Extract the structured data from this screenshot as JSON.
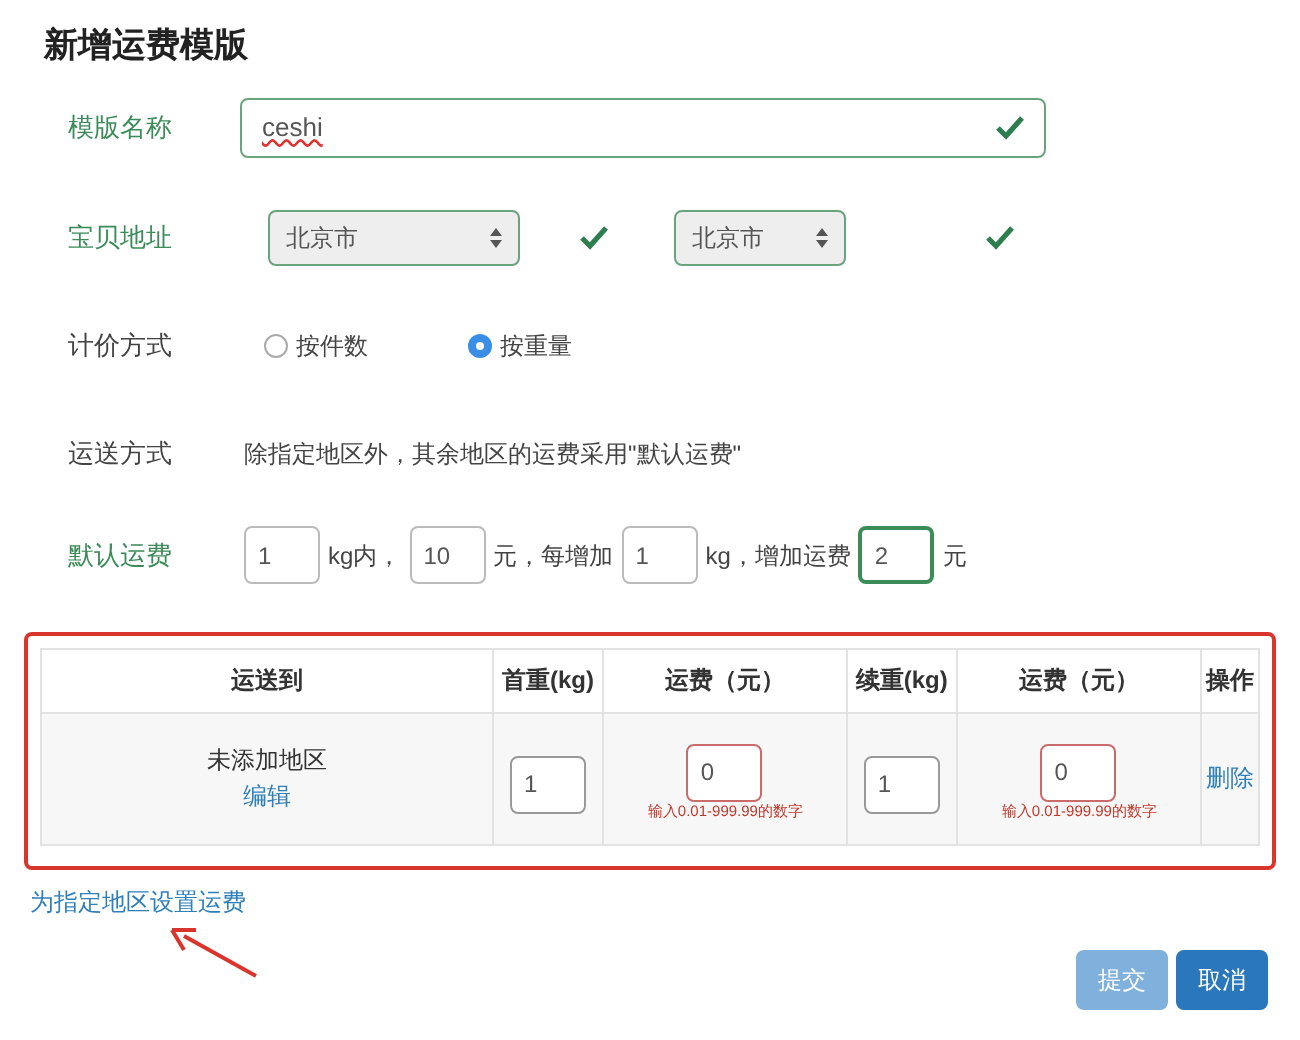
{
  "title": "新增运费模版",
  "name_field": {
    "label": "模版名称",
    "value": "ceshi",
    "valid": true
  },
  "address": {
    "label": "宝贝地址",
    "valid": true,
    "selects": [
      {
        "value": "北京市",
        "valid": true
      },
      {
        "value": "北京市",
        "valid": true
      }
    ]
  },
  "pricing": {
    "label": "计价方式",
    "options": [
      {
        "label": "按件数",
        "selected": false
      },
      {
        "label": "按重量",
        "selected": true
      }
    ]
  },
  "shipping": {
    "label": "运送方式",
    "note": "除指定地区外，其余地区的运费采用\"默认运费\""
  },
  "default_fee": {
    "label": "默认运费",
    "valid": true,
    "parts": [
      {
        "kind": "input",
        "value": "1",
        "focused": false
      },
      {
        "kind": "text",
        "text": "kg内，"
      },
      {
        "kind": "input",
        "value": "10",
        "focused": false
      },
      {
        "kind": "text",
        "text": "元，每增加"
      },
      {
        "kind": "input",
        "value": "1",
        "focused": false
      },
      {
        "kind": "text",
        "text": "kg，增加运费"
      },
      {
        "kind": "input",
        "value": "2",
        "focused": true
      },
      {
        "kind": "text",
        "text": "元"
      }
    ]
  },
  "table": {
    "columns": [
      "运送到",
      "首重(kg)",
      "运费（元）",
      "续重(kg)",
      "运费（元）",
      "操作"
    ],
    "rows": [
      {
        "cells": [
          {
            "kind": "region",
            "text": "未添加地区",
            "link": "编辑"
          },
          {
            "kind": "input",
            "value": "1",
            "error": false
          },
          {
            "kind": "input",
            "value": "0",
            "error": true,
            "hint": "输入0.01-999.99的数字"
          },
          {
            "kind": "input",
            "value": "1",
            "error": false
          },
          {
            "kind": "input",
            "value": "0",
            "error": true,
            "hint": "输入0.01-999.99的数字"
          },
          {
            "kind": "action",
            "text": "删除"
          }
        ]
      }
    ]
  },
  "link": "为指定地区设置运费",
  "buttons": [
    {
      "label": "提交",
      "disabled": true
    },
    {
      "label": "取消",
      "disabled": false
    }
  ]
}
